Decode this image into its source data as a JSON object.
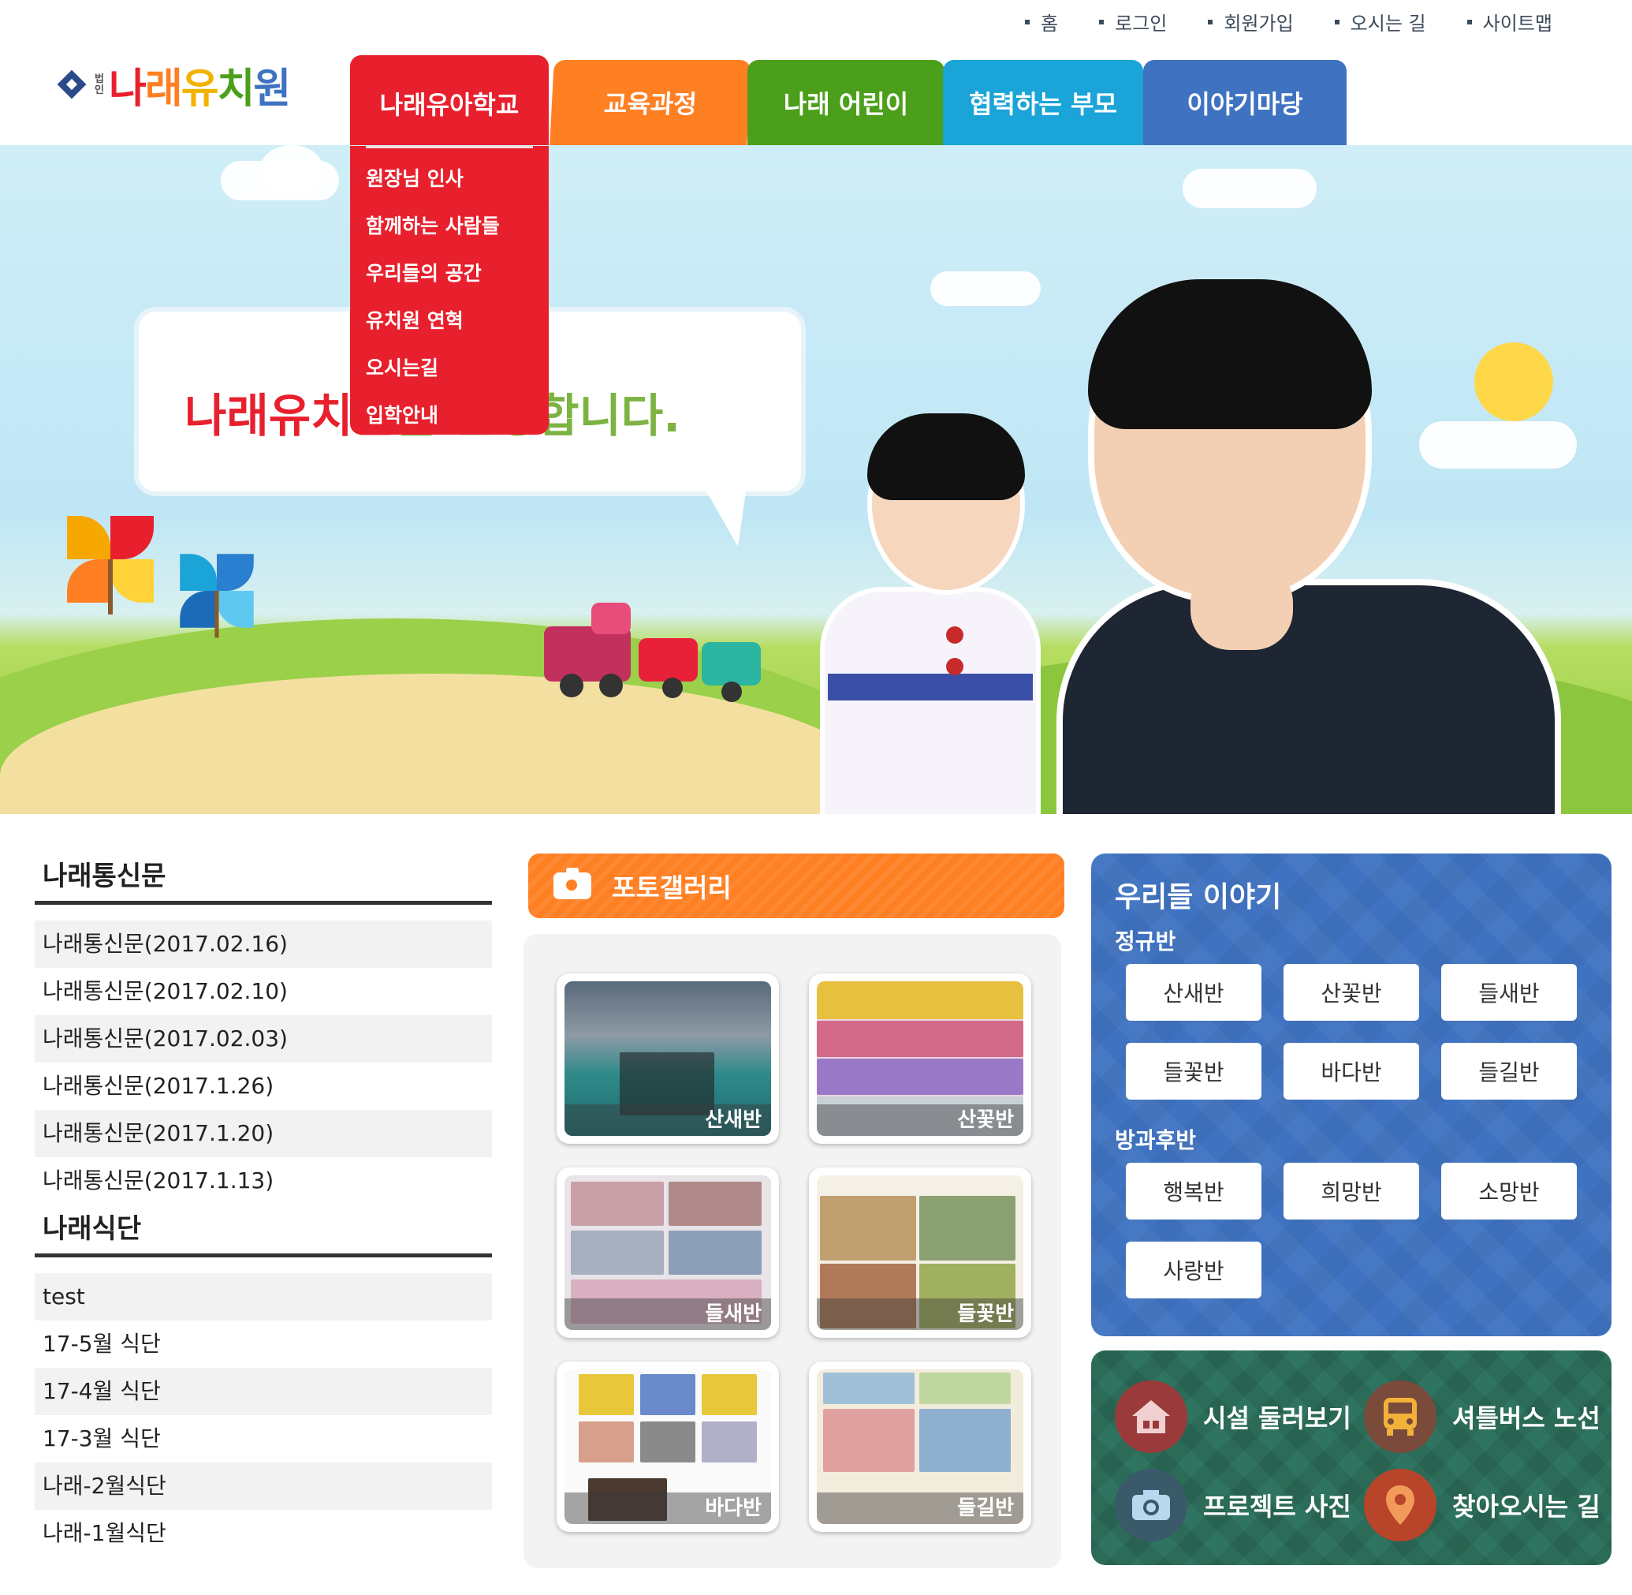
{
  "util_links": [
    "홈",
    "로그인",
    "회원가입",
    "오시는 길",
    "사이트맵"
  ],
  "logo": {
    "corp": "법인",
    "name_chars": [
      "나",
      "래",
      "유",
      "치",
      "원"
    ]
  },
  "nav": {
    "tabs": [
      "나래유아학교",
      "교육과정",
      "나래 어린이",
      "협력하는 부모",
      "이야기마당"
    ],
    "dropdown": [
      "원장님 인사",
      "함께하는 사람들",
      "우리들의 공간",
      "유치원 연혁",
      "오시는길",
      "입학안내"
    ]
  },
  "hero": {
    "welcome_prefix": "나래유치원",
    "welcome_suffix": "을 환영합니다."
  },
  "newsletter": {
    "title": "나래통신문",
    "items": [
      "나래통신문(2017.02.16)",
      "나래통신문(2017.02.10)",
      "나래통신문(2017.02.03)",
      "나래통신문(2017.1.26)",
      "나래통신문(2017.1.20)",
      "나래통신문(2017.1.13)"
    ]
  },
  "menu": {
    "title": "나래식단",
    "items": [
      "test",
      "17-5월 식단",
      "17-4월 식단",
      "17-3월 식단",
      "나래-2월식단",
      "나래-1월식단"
    ]
  },
  "gallery": {
    "title": "포토갤러리",
    "thumbs": [
      "산새반",
      "산꽃반",
      "들새반",
      "들꽃반",
      "바다반",
      "들길반"
    ]
  },
  "stories": {
    "title": "우리들 이야기",
    "regular_label": "정규반",
    "regular": [
      "산새반",
      "산꽃반",
      "들새반",
      "들꽃반",
      "바다반",
      "들길반"
    ],
    "after_label": "방과후반",
    "after": [
      "행복반",
      "희망반",
      "소망반",
      "사랑반"
    ]
  },
  "quick_links": [
    "시설 둘러보기",
    "셔틀버스 노선",
    "프로젝트 사진",
    "찾아오시는 길"
  ],
  "colors": {
    "red": "#e8202d",
    "orange": "#ff7f23",
    "green": "#4c9f1b",
    "sky": "#1aa4d8",
    "blue": "#3f73c1",
    "teal": "#2f7460"
  }
}
